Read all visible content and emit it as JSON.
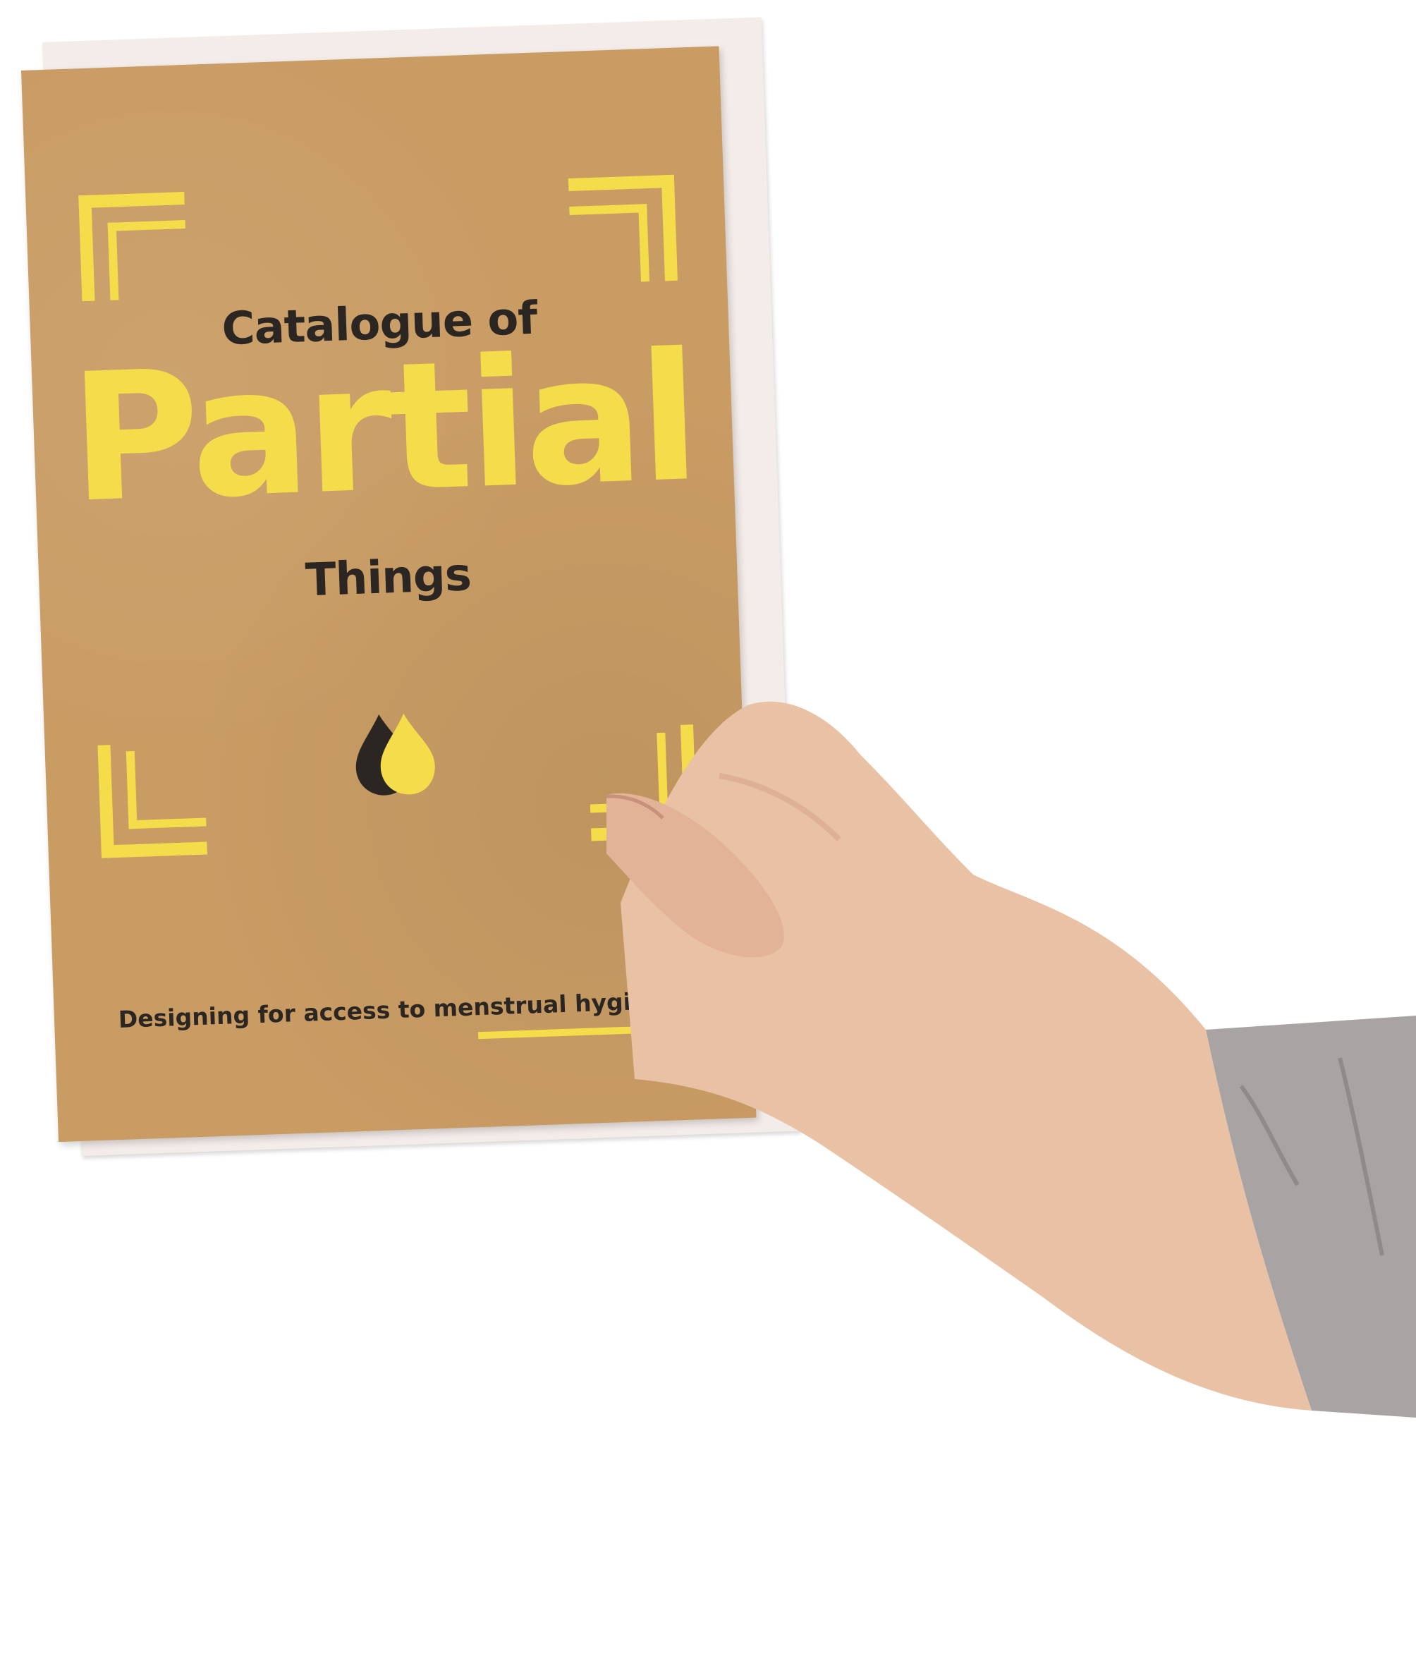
{
  "booklet": {
    "title_line_1": "Catalogue of",
    "title_main": "Partial",
    "title_line_3": "Things",
    "tagline": "Designing for access to menstrual hygiene.",
    "logo_icon": "twin-drop-icon"
  },
  "colors": {
    "kraft": "#c99c64",
    "yellow": "#f4dc4a",
    "ink": "#2b2622",
    "skin": "#e9c2a6",
    "sleeve": "#a8a4a4"
  }
}
